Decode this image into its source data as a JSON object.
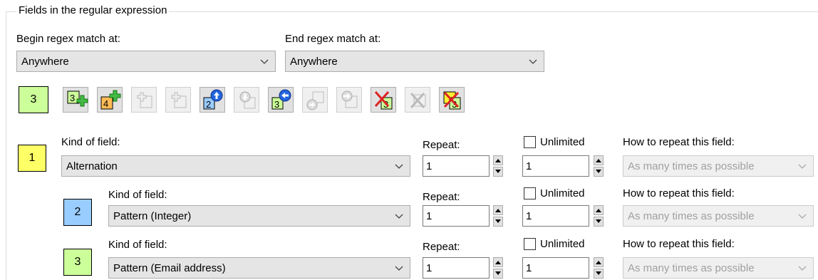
{
  "group": {
    "title": "Fields in the regular expression"
  },
  "begin": {
    "label": "Begin regex match at:",
    "value": "Anywhere"
  },
  "end": {
    "label": "End regex match at:",
    "value": "Anywhere"
  },
  "toolbar": {
    "count": "3",
    "colors": {
      "green": "#ccff99",
      "yellow": "#ffff66",
      "blue": "#99ccff"
    },
    "buttons": [
      {
        "icon": "add-field-after-icon",
        "number": "3"
      },
      {
        "icon": "add-field-before-icon",
        "number": "4"
      },
      {
        "icon": "insert-disabled-icon"
      },
      {
        "icon": "insert-disabled-icon"
      },
      {
        "icon": "move-up-icon",
        "number": "2"
      },
      {
        "icon": "move-down-disabled-icon"
      },
      {
        "icon": "move-left-icon",
        "number": "3"
      },
      {
        "icon": "move-disabled-icon"
      },
      {
        "icon": "move-right-disabled-icon"
      },
      {
        "icon": "delete-field-icon",
        "number": "3"
      },
      {
        "icon": "delete-disabled-icon"
      },
      {
        "icon": "delete-all-icon",
        "number": "3"
      }
    ]
  },
  "fields": [
    {
      "num": "1",
      "kind_label": "Kind of field:",
      "kind_value": "Alternation",
      "repeat_label": "Repeat:",
      "repeat_value": "1",
      "unlimited_label": "Unlimited",
      "unlimited_value": "1",
      "unlimited_checked": false,
      "how_label": "How to repeat this field:",
      "how_value": "As many times as possible"
    },
    {
      "num": "2",
      "kind_label": "Kind of field:",
      "kind_value": "Pattern (Integer)",
      "repeat_label": "Repeat:",
      "repeat_value": "1",
      "unlimited_label": "Unlimited",
      "unlimited_value": "1",
      "unlimited_checked": false,
      "how_label": "How to repeat this field:",
      "how_value": "As many times as possible"
    },
    {
      "num": "3",
      "kind_label": "Kind of field:",
      "kind_value": "Pattern (Email address)",
      "repeat_label": "Repeat:",
      "repeat_value": "1",
      "unlimited_label": "Unlimited",
      "unlimited_value": "1",
      "unlimited_checked": false,
      "how_label": "How to repeat this field:",
      "how_value": "As many times as possible"
    }
  ]
}
